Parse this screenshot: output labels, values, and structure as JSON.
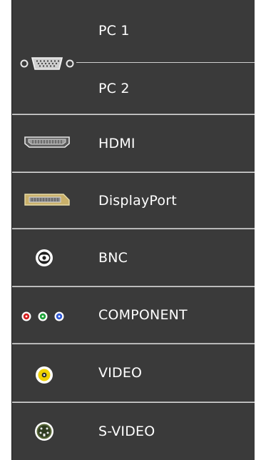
{
  "sources": {
    "pc1": {
      "label": "PC 1",
      "icon": "vga-port-icon"
    },
    "pc2": {
      "label": "PC 2",
      "icon": "vga-port-icon"
    },
    "hdmi": {
      "label": "HDMI",
      "icon": "hdmi-port-icon"
    },
    "displayport": {
      "label": "DisplayPort",
      "icon": "displayport-icon"
    },
    "bnc": {
      "label": "BNC",
      "icon": "bnc-connector-icon"
    },
    "component": {
      "label": "COMPONENT",
      "icon": "component-rca-icon"
    },
    "video": {
      "label": "VIDEO",
      "icon": "video-rca-icon"
    },
    "svideo": {
      "label": "S-VIDEO",
      "icon": "svideo-port-icon"
    }
  },
  "colors": {
    "panel_background": "#3a3a3a",
    "divider": "#d8d8d8",
    "text": "#ffffff",
    "component_red": "#d42020",
    "component_green": "#1fa33a",
    "component_blue": "#2f58d6",
    "video_yellow": "#f0d200"
  }
}
